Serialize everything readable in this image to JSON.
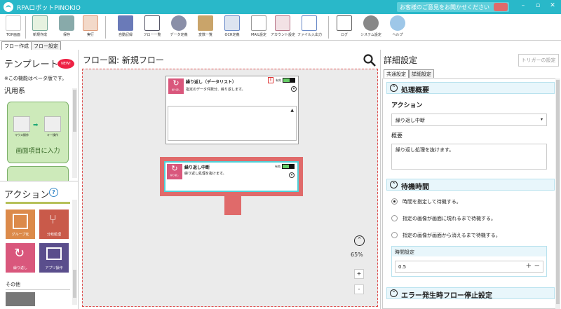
{
  "titlebar": {
    "title": "RPAロボットPINOKIO",
    "feedback": "お客様のご意見をお聞かせください",
    "minimize": "–",
    "maximize": "▫",
    "close": "✕"
  },
  "toolbar": {
    "top_page": "TOP画面",
    "buttons": [
      "新規作成",
      "保存",
      "実行",
      "自動記録",
      "フロー一覧",
      "データ定義",
      "変数一覧",
      "OCR定義",
      "MAIL設定",
      "アカウント設定",
      "ファイル入出力",
      "ログ",
      "システム設定",
      "ヘルプ"
    ]
  },
  "tabs": [
    "フロー作成",
    "フロー設定"
  ],
  "left": {
    "template_title": "テンプレート",
    "new_badge": "NEW!",
    "beta_note": "※この機能はベータ版です。",
    "category": "汎用系",
    "template_card": {
      "label": "画面項目に入力",
      "mouse_label": "マウス操作",
      "keyboard_label": "キー操作"
    },
    "action_title": "アクション",
    "help": "?",
    "actions": [
      "グループ化",
      "分岐処理",
      "繰り返し",
      "アプリ操作"
    ],
    "other": "その他"
  },
  "center": {
    "title": "フロー図: 新規フロー",
    "node1": {
      "title": "繰り返し（データリスト）",
      "desc": "指定のデータ件数分、繰り返します。",
      "icon_label": "繰り返し",
      "warn": "!",
      "valid": "有効"
    },
    "node2": {
      "title": "繰り返し中断",
      "desc": "繰り返し処理を抜けます。",
      "icon_label": "繰り返し",
      "valid": "有効"
    },
    "zoom": "65%",
    "zoom_in": "+",
    "zoom_out": "-"
  },
  "right": {
    "title": "詳細設定",
    "trigger": "トリガーの設定",
    "tabs": [
      "共通設定",
      "詳細設定"
    ],
    "section1": "処理概要",
    "action_label": "アクション",
    "action_value": "繰り返し中断",
    "summary_label": "概要",
    "summary_value": "繰り返し処理を抜けます。",
    "section2": "待機時間",
    "radios": [
      "時間を指定して待機する。",
      "指定の画像が画面に現れるまで待機する。",
      "指定の画像が画面から消えるまで待機する。"
    ],
    "time_label": "時間設定",
    "time_value": "0.5",
    "plus": "+",
    "minus": "−",
    "section3": "エラー発生時フロー停止設定"
  },
  "colors": {
    "accent": "#29b8c9",
    "node_pink": "#d9577c",
    "arrow": "#e06a6a",
    "action_orange": "#dc8a4a",
    "action_red": "#c95a4a",
    "action_purple": "#5a4e8c"
  }
}
